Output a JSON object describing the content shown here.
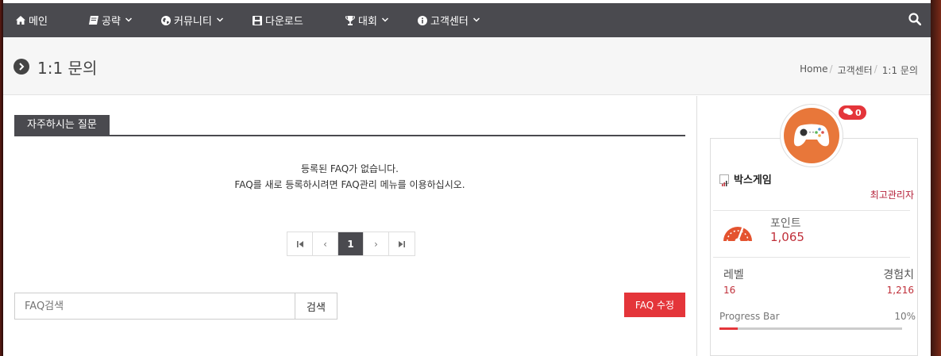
{
  "nav": {
    "items": [
      {
        "label": "메인",
        "icon": "home-icon",
        "dropdown": false
      },
      {
        "label": "공략",
        "icon": "book-icon",
        "dropdown": true
      },
      {
        "label": "커뮤니티",
        "icon": "globe-icon",
        "dropdown": true
      },
      {
        "label": "다운로드",
        "icon": "save-icon",
        "dropdown": false
      },
      {
        "label": "대회",
        "icon": "trophy-icon",
        "dropdown": true
      },
      {
        "label": "고객센터",
        "icon": "info-icon",
        "dropdown": true
      }
    ],
    "search_icon": "search-icon"
  },
  "titlebar": {
    "title": "1:1 문의",
    "breadcrumb": [
      "Home",
      "고객센터",
      "1:1 문의"
    ]
  },
  "main": {
    "section_title": "자주하시는 질문",
    "empty_line1": "등록된 FAQ가 없습니다.",
    "empty_line2": "FAQ를 새로 등록하시려면 FAQ관리 메뉴를 이용하십시오.",
    "pager": {
      "first": "⏮",
      "prev": "‹",
      "current": "1",
      "next": "›",
      "last": "⏭"
    },
    "search_placeholder": "FAQ검색",
    "search_button": "검색",
    "faq_edit_button": "FAQ 수정"
  },
  "sidebar": {
    "message_count": "0",
    "username": "박스게임",
    "role": "최고관리자",
    "points_label": "포인트",
    "points_value": "1,065",
    "level_label": "레벨",
    "level_value": "16",
    "exp_label": "경험치",
    "exp_value": "1,216",
    "progress_label": "Progress Bar",
    "progress_text": "10%",
    "progress_fraction": 0.1
  },
  "colors": {
    "nav_bg": "#4a4a4f",
    "accent_red": "#e4353a",
    "avatar_orange": "#e8773a"
  }
}
